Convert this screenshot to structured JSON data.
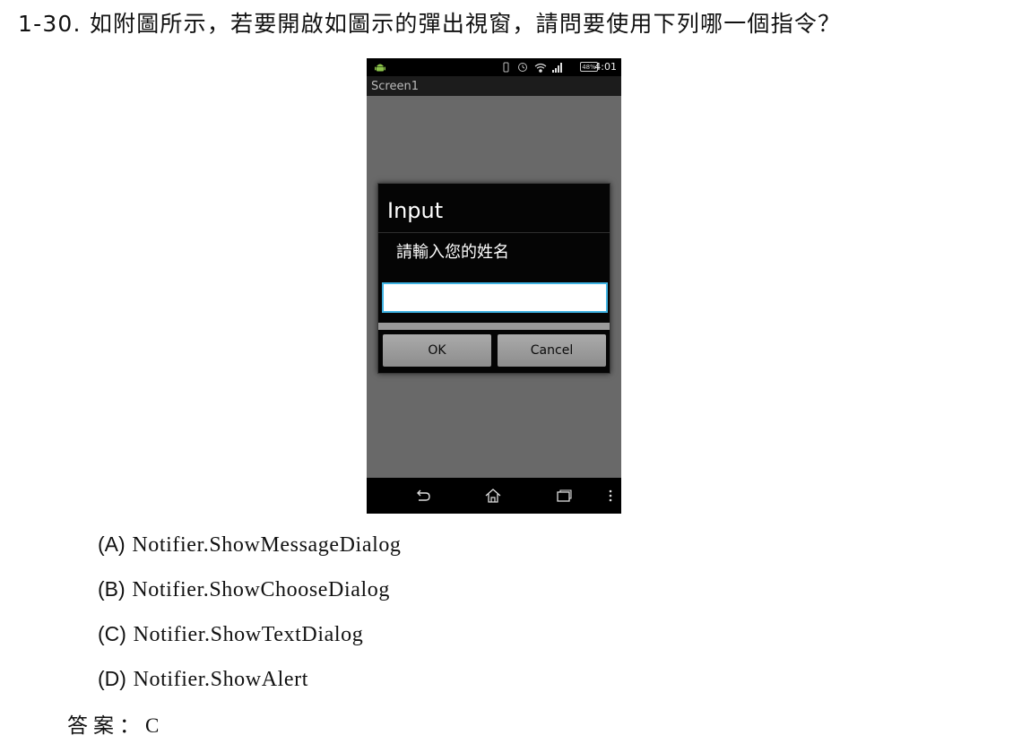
{
  "question": {
    "text": "1-30. 如附圖所示，若要開啟如圖示的彈出視窗，請問要使用下列哪一個指令？"
  },
  "phone": {
    "status_bar": {
      "time": "4:01",
      "battery": "48%",
      "icons": [
        "android-icon",
        "vibrate-icon",
        "alarm-icon",
        "wifi-icon",
        "signal-icon"
      ]
    },
    "screen_title": "Screen1",
    "dialog": {
      "title": "Input",
      "message": "請輸入您的姓名",
      "input_value": "",
      "ok_label": "OK",
      "cancel_label": "Cancel"
    },
    "nav_icons": [
      "back-icon",
      "home-icon",
      "recent-apps-icon",
      "menu-icon"
    ],
    "colors": {
      "screen_bg": "#696969",
      "dialog_bg": "#050505",
      "input_border": "#3fb3e3"
    }
  },
  "options": [
    {
      "letter": "(A)",
      "text": "Notifier.ShowMessageDialog"
    },
    {
      "letter": "(B)",
      "text": "Notifier.ShowChooseDialog"
    },
    {
      "letter": "(C)",
      "text": "Notifier.ShowTextDialog"
    },
    {
      "letter": "(D)",
      "text": "Notifier.ShowAlert"
    }
  ],
  "answer": {
    "label": "答案：",
    "value": "C"
  }
}
